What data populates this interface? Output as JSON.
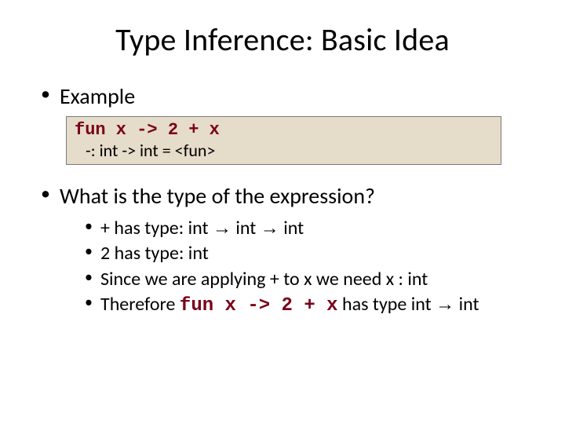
{
  "title": "Type Inference: Basic Idea",
  "bullet1": "Example",
  "code_line": "fun x -> 2 + x",
  "result_line": "-: int -> int = <fun>",
  "bullet2": "What is the type of the expression?",
  "sub": {
    "a_prefix": "+  has type: int ",
    "a_mid": " int ",
    "a_suffix": " int",
    "b": "2 has type: int",
    "c": "Since we are applying + to x we need x : int",
    "d_prefix": "Therefore ",
    "d_code": "fun x -> 2 + x",
    "d_mid": "  has type int ",
    "d_suffix": " int"
  },
  "glyph_arrow": "→"
}
